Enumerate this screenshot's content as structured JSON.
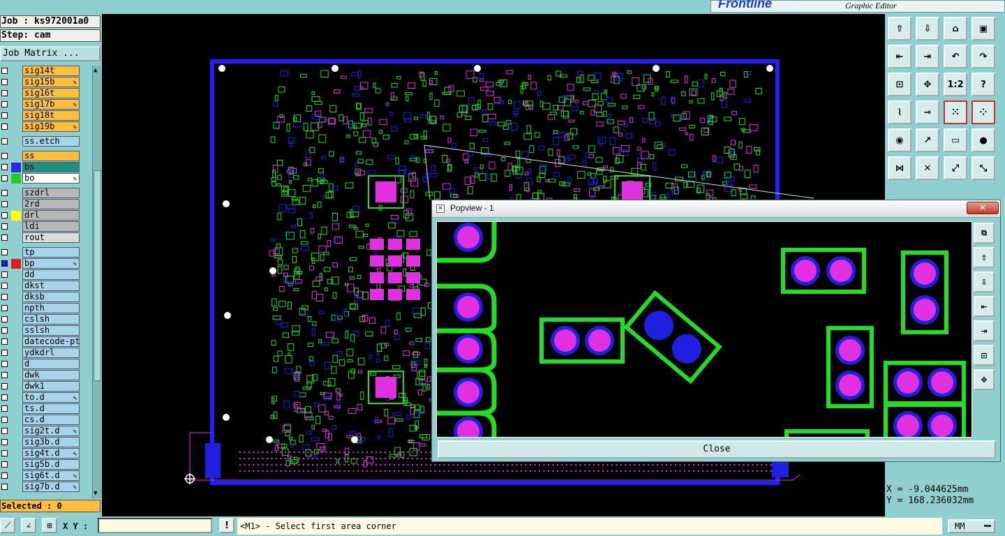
{
  "app": {
    "logo_text": "Frontline",
    "subtitle": "Graphic Editor"
  },
  "left_panel": {
    "job": "Job : ks972001a0",
    "step": "Step: cam",
    "job_matrix_label": "Job Matrix ...",
    "selected": "Selected : 0",
    "layers": [
      {
        "name": "sig14t",
        "bg": "#ffbe3c",
        "sw": null,
        "edit": false
      },
      {
        "name": "sig15b",
        "bg": "#ffbe3c",
        "sw": null,
        "edit": true
      },
      {
        "name": "sig16t",
        "bg": "#ffbe3c",
        "sw": null,
        "edit": false
      },
      {
        "name": "sig17b",
        "bg": "#ffbe3c",
        "sw": null,
        "edit": true
      },
      {
        "name": "sig18t",
        "bg": "#ffbe3c",
        "sw": null,
        "edit": false
      },
      {
        "name": "sig19b",
        "bg": "#ffbe3c",
        "sw": null,
        "edit": true
      },
      {
        "gap": true
      },
      {
        "name": "ss.etch",
        "bg": "#a6d4ea",
        "sw": null,
        "edit": false
      },
      {
        "gap": true
      },
      {
        "name": "ss",
        "bg": "#ffbe3c",
        "sw": null,
        "edit": false
      },
      {
        "name": "bs",
        "bg": "#1f8f7f",
        "sw": "#2a2ae0",
        "edit": false
      },
      {
        "name": "bo",
        "bg": "#ffffff",
        "sw": "#22cc22",
        "edit": true
      },
      {
        "gap": true
      },
      {
        "name": "szdrl",
        "bg": "#b8b8b8",
        "sw": null,
        "edit": false
      },
      {
        "name": "2rd",
        "bg": "#b8b8b8",
        "sw": null,
        "edit": false
      },
      {
        "name": "drl",
        "bg": "#b8b8b8",
        "sw": "#ffff00",
        "edit": false
      },
      {
        "name": "ldi",
        "bg": "#b8b8b8",
        "sw": null,
        "edit": false
      },
      {
        "name": "rout",
        "bg": "#dcdcdc",
        "sw": null,
        "edit": false
      },
      {
        "gap": true
      },
      {
        "name": "tp",
        "bg": "#a6d4ea",
        "sw": null,
        "edit": false
      },
      {
        "name": "bp",
        "bg": "#a6d4ea",
        "sw": "#e02020",
        "edit": true,
        "sel": true
      },
      {
        "name": "dd",
        "bg": "#a6d4ea",
        "sw": null,
        "edit": false
      },
      {
        "name": "dkst",
        "bg": "#a6d4ea",
        "sw": null,
        "edit": false
      },
      {
        "name": "dksb",
        "bg": "#a6d4ea",
        "sw": null,
        "edit": false
      },
      {
        "name": "npth",
        "bg": "#a6d4ea",
        "sw": null,
        "edit": false
      },
      {
        "name": "cslsh",
        "bg": "#a6d4ea",
        "sw": null,
        "edit": false
      },
      {
        "name": "sslsh",
        "bg": "#a6d4ea",
        "sw": null,
        "edit": false
      },
      {
        "name": "datecode-ptc",
        "bg": "#a6d4ea",
        "sw": null,
        "edit": false
      },
      {
        "name": "ydkdrl",
        "bg": "#a6d4ea",
        "sw": null,
        "edit": false
      },
      {
        "name": "d",
        "bg": "#a6d4ea",
        "sw": null,
        "edit": false
      },
      {
        "name": "dwk",
        "bg": "#a6d4ea",
        "sw": null,
        "edit": false
      },
      {
        "name": "dwk1",
        "bg": "#a6d4ea",
        "sw": null,
        "edit": false
      },
      {
        "name": "to.d",
        "bg": "#a6d4ea",
        "sw": null,
        "edit": true
      },
      {
        "name": "ts.d",
        "bg": "#a6d4ea",
        "sw": null,
        "edit": false
      },
      {
        "name": "cs.d",
        "bg": "#a6d4ea",
        "sw": null,
        "edit": false
      },
      {
        "name": "sig2t.d",
        "bg": "#a6d4ea",
        "sw": null,
        "edit": true
      },
      {
        "name": "sig3b.d",
        "bg": "#a6d4ea",
        "sw": null,
        "edit": false
      },
      {
        "name": "sig4t.d",
        "bg": "#a6d4ea",
        "sw": null,
        "edit": true
      },
      {
        "name": "sig5b.d",
        "bg": "#a6d4ea",
        "sw": null,
        "edit": false
      },
      {
        "name": "sig6t.d",
        "bg": "#a6d4ea",
        "sw": null,
        "edit": true
      },
      {
        "name": "sig7b.d",
        "bg": "#a6d4ea",
        "sw": null,
        "edit": true
      }
    ]
  },
  "right_toolbar": {
    "buttons": [
      {
        "name": "up-level-icon",
        "glyph": "⇧"
      },
      {
        "name": "down-level-icon",
        "glyph": "⇩"
      },
      {
        "name": "home-icon",
        "glyph": "⌂"
      },
      {
        "name": "panel-icon",
        "glyph": "▣"
      },
      {
        "name": "pan-left-icon",
        "glyph": "⇤"
      },
      {
        "name": "pan-right-icon",
        "glyph": "⇥"
      },
      {
        "name": "undo-icon",
        "glyph": "↶"
      },
      {
        "name": "redo-icon",
        "glyph": "↷"
      },
      {
        "name": "zoom-fit-icon",
        "glyph": "⊡"
      },
      {
        "name": "center-icon",
        "glyph": "✥"
      },
      {
        "name": "scale-icon",
        "glyph": "1:2"
      },
      {
        "name": "help-icon",
        "glyph": "?"
      },
      {
        "name": "measure-icon",
        "glyph": "⌇"
      },
      {
        "name": "probe-icon",
        "glyph": "⊸"
      },
      {
        "name": "net-icon",
        "glyph": "⁙"
      },
      {
        "name": "net2-icon",
        "glyph": "⁘"
      },
      {
        "name": "select-icon",
        "glyph": "◉"
      },
      {
        "name": "move-icon",
        "glyph": "↗"
      },
      {
        "name": "ruler-icon",
        "glyph": "▭"
      },
      {
        "name": "snap-icon",
        "glyph": "●"
      },
      {
        "name": "connect-icon",
        "glyph": "⋈"
      },
      {
        "name": "cross-icon",
        "glyph": "✕"
      },
      {
        "name": "link-icon",
        "glyph": "⤢"
      },
      {
        "name": "link2-icon",
        "glyph": "⤡"
      }
    ],
    "coord_x": "X = -9.044625mm",
    "coord_y": "Y = 168.236032mm"
  },
  "popview": {
    "title": "Popview - 1",
    "close_label": "Close",
    "close_x": "✕",
    "tools": [
      "zoom-window-icon",
      "zoom-home-icon",
      "zoom-print-icon",
      "zoom-in-icon",
      "zoom-out-icon",
      "fit-icon",
      "pan-icon"
    ]
  },
  "bottom": {
    "xy_label": "X Y :",
    "xy_value": "",
    "status": "<M1> - Select first area corner",
    "units": "MM"
  },
  "colors": {
    "board_outline": "#1f1fff",
    "pad_green": "#22dd22",
    "pad_magenta": "#e030e0",
    "pad_blue": "#2020e0",
    "panel_teal": "#8fcfcf"
  }
}
